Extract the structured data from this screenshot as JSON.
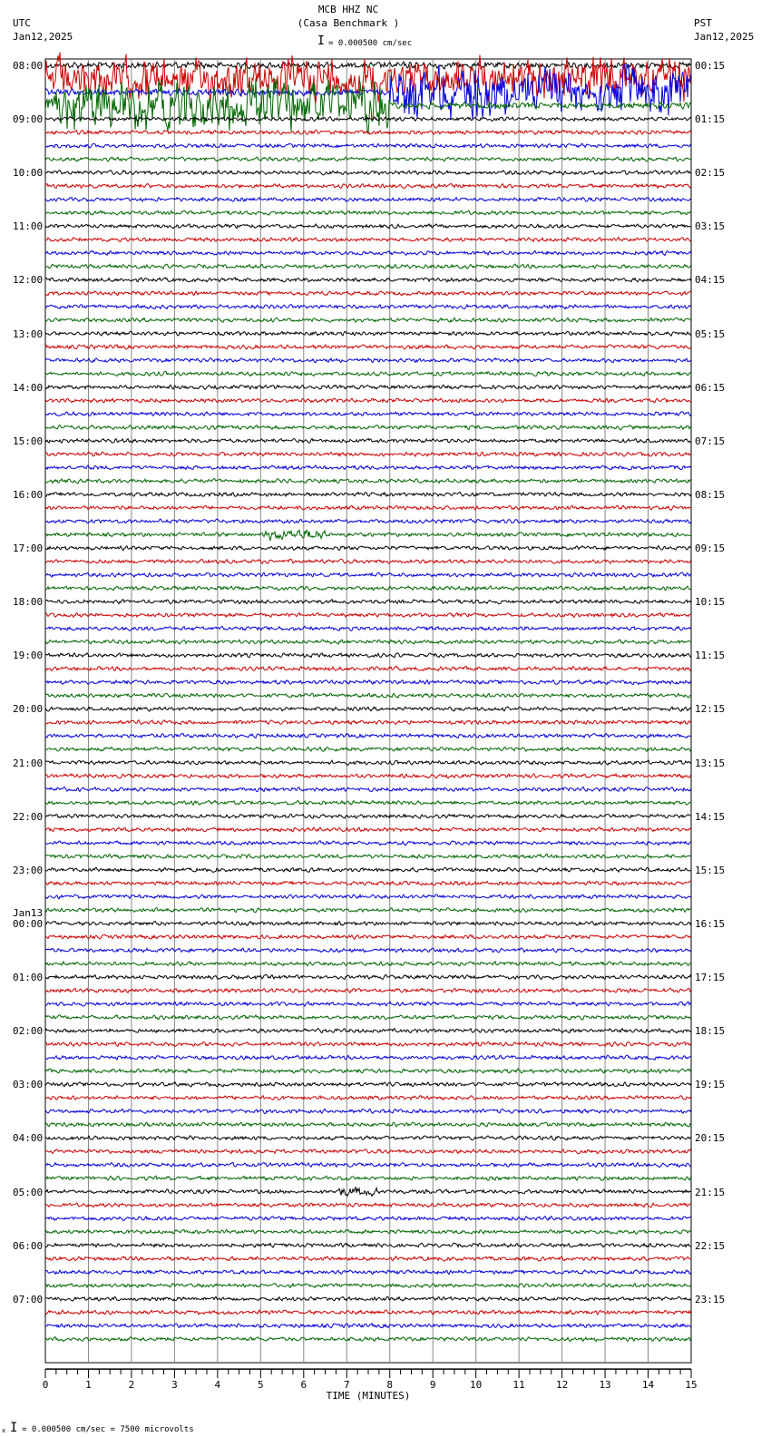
{
  "header": {
    "title": "MCB HHZ NC",
    "subtitle": "(Casa Benchmark )",
    "left_tz": "UTC",
    "left_date": "Jan12,2025",
    "right_tz": "PST",
    "right_date": "Jan12,2025",
    "scale_text": "= 0.000500 cm/sec"
  },
  "footer": {
    "prefix": "x",
    "scale_text": "= 0.000500 cm/sec =    7500 microvolts"
  },
  "colors": {
    "trace_cycle": [
      "#000000",
      "#cc0000",
      "#0000dd",
      "#006600"
    ],
    "grid": "#888888"
  },
  "chart_data": {
    "type": "line",
    "title": "MCB HHZ NC",
    "xlabel": "TIME (MINUTES)",
    "xlim": [
      0,
      15
    ],
    "x_ticks": [
      "0",
      "1",
      "2",
      "3",
      "4",
      "5",
      "6",
      "7",
      "8",
      "9",
      "10",
      "11",
      "12",
      "13",
      "14",
      "15"
    ],
    "rows_per_hour": 4,
    "row_minutes": 15,
    "left_labels": [
      "08:00",
      "09:00",
      "10:00",
      "11:00",
      "12:00",
      "13:00",
      "14:00",
      "15:00",
      "16:00",
      "17:00",
      "18:00",
      "19:00",
      "20:00",
      "21:00",
      "22:00",
      "23:00",
      "00:00",
      "01:00",
      "02:00",
      "03:00",
      "04:00",
      "05:00",
      "06:00",
      "07:00"
    ],
    "date_change_label": "Jan13",
    "right_labels": [
      "00:15",
      "01:15",
      "02:15",
      "03:15",
      "04:15",
      "05:15",
      "06:15",
      "07:15",
      "08:15",
      "09:15",
      "10:15",
      "11:15",
      "12:15",
      "13:15",
      "14:15",
      "15:15",
      "16:15",
      "17:15",
      "18:15",
      "19:15",
      "20:15",
      "21:15",
      "22:15",
      "23:15"
    ],
    "events": [
      {
        "row": 1,
        "start_min": 0,
        "end_min": 15,
        "amp": 5
      },
      {
        "row": 2,
        "start_min": 8,
        "end_min": 15,
        "amp": 6
      },
      {
        "row": 3,
        "start_min": 0,
        "end_min": 8,
        "amp": 6
      },
      {
        "row": 35,
        "start_min": 5.1,
        "end_min": 6.5,
        "amp": 3
      },
      {
        "row": 84,
        "start_min": 6.8,
        "end_min": 7.7,
        "amp": 2.5
      }
    ]
  }
}
